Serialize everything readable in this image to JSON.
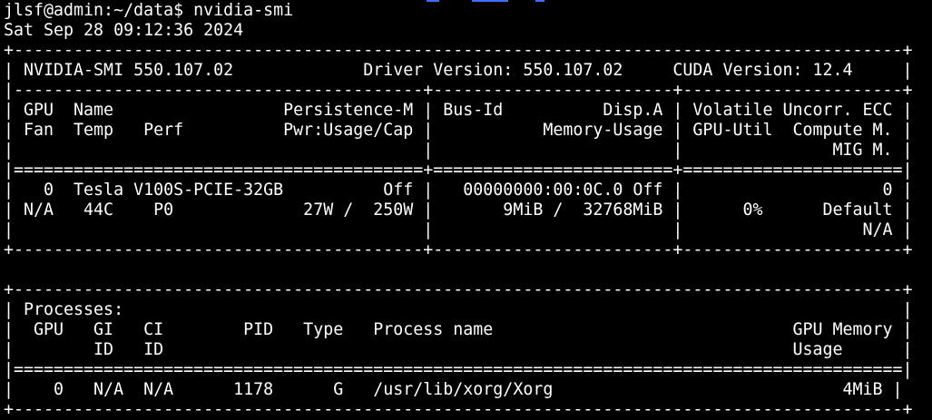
{
  "terminal": {
    "prompt": "jlsf@admin:~/data$ nvidia-smi",
    "timestamp": "Sat Sep 28 09:12:36 2024",
    "gpu_table": {
      "lines": [
        "+-----------------------------------------------------------------------------------------+",
        "| NVIDIA-SMI 550.107.02             Driver Version: 550.107.02     CUDA Version: 12.4     |",
        "|-----------------------------------------+------------------------+----------------------+",
        "| GPU  Name                 Persistence-M | Bus-Id          Disp.A | Volatile Uncorr. ECC |",
        "| Fan  Temp   Perf          Pwr:Usage/Cap |           Memory-Usage | GPU-Util  Compute M. |",
        "|                                         |                        |               MIG M. |",
        "|=========================================+========================+======================|",
        "|   0  Tesla V100S-PCIE-32GB          Off |   00000000:00:0C.0 Off |                    0 |",
        "| N/A   44C    P0             27W /  250W |       9MiB /  32768MiB |      0%      Default |",
        "|                                         |                        |                  N/A |",
        "+-----------------------------------------+------------------------+----------------------+"
      ]
    },
    "spacer": " ",
    "process_table": {
      "lines": [
        "+-----------------------------------------------------------------------------------------+",
        "| Processes:                                                                              |",
        "|  GPU   GI   CI        PID   Type   Process name                              GPU Memory |",
        "|        ID   ID                                                               Usage      |",
        "|=========================================================================================|",
        "|    0   N/A  N/A      1178      G   /usr/lib/xorg/Xorg                             4MiB |",
        "+-----------------------------------------------------------------------------------------+"
      ]
    }
  },
  "colors": {
    "background": "#000000",
    "foreground": "#ffffff",
    "top_artifact": "#3a6fff"
  }
}
